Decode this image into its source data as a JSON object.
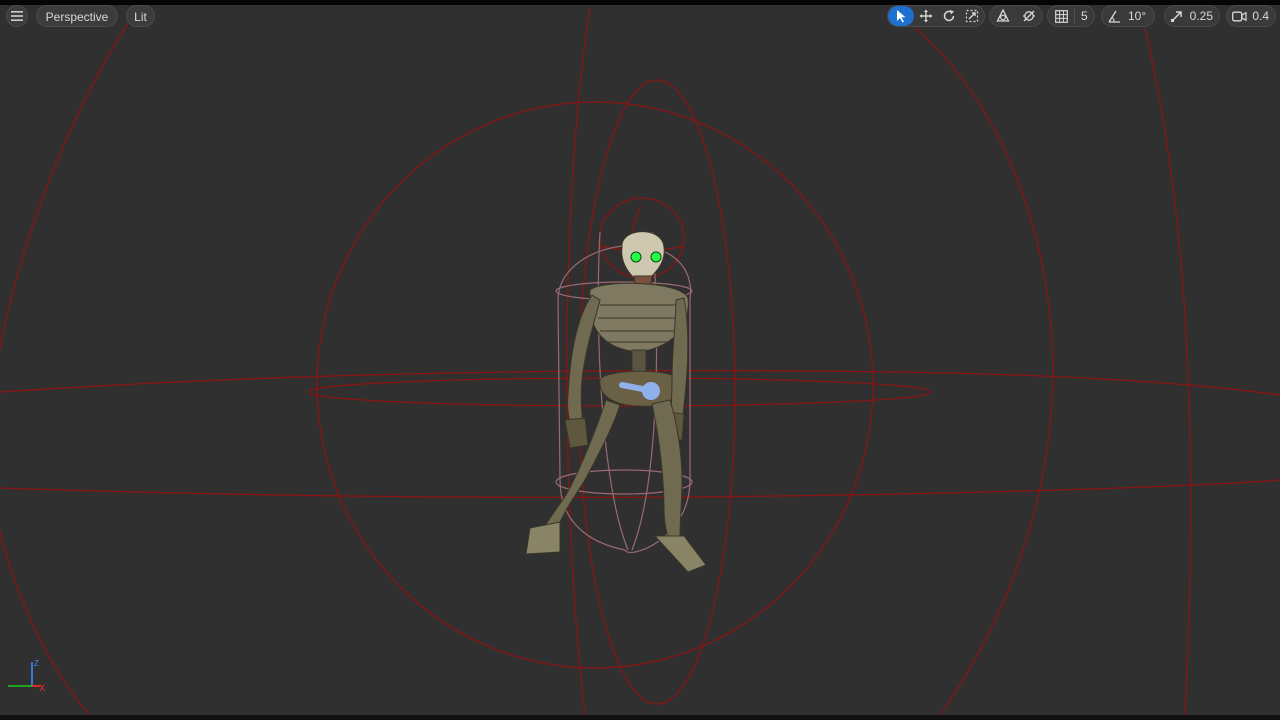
{
  "viewport": {
    "menu_icon": "hamburger-menu-icon",
    "view_mode": "Perspective",
    "lighting_mode": "Lit"
  },
  "toolbar": {
    "select_icon": "select-arrow-icon",
    "translate_icon": "translate-move-icon",
    "rotate_icon": "rotate-icon",
    "scale_icon": "scale-icon",
    "world_local_icon": "coordinate-space-icon",
    "surface_snap_icon": "surface-snapping-icon",
    "grid_snap_icon": "grid-snap-icon",
    "grid_snap_value": "5",
    "rotation_snap_icon": "angle-snap-icon",
    "rotation_snap_value": "10°",
    "scale_snap_icon": "scale-snap-icon",
    "scale_snap_value": "0.25",
    "camera_speed_icon": "camera-speed-icon",
    "camera_speed_value": "0.4"
  },
  "axis_gizmo": {
    "x_label": "X",
    "z_label": "Z",
    "colors": {
      "x": "#ff2a2a",
      "y": "#1ec81e",
      "z": "#3a8cff"
    }
  },
  "colors": {
    "background": "#303030",
    "wireframe": "#8a1414",
    "capsule": "#9a6a72",
    "active_tool": "#1e6fd0",
    "eye_glow": "#22ff44",
    "root_bone": "#8fb0ea"
  }
}
